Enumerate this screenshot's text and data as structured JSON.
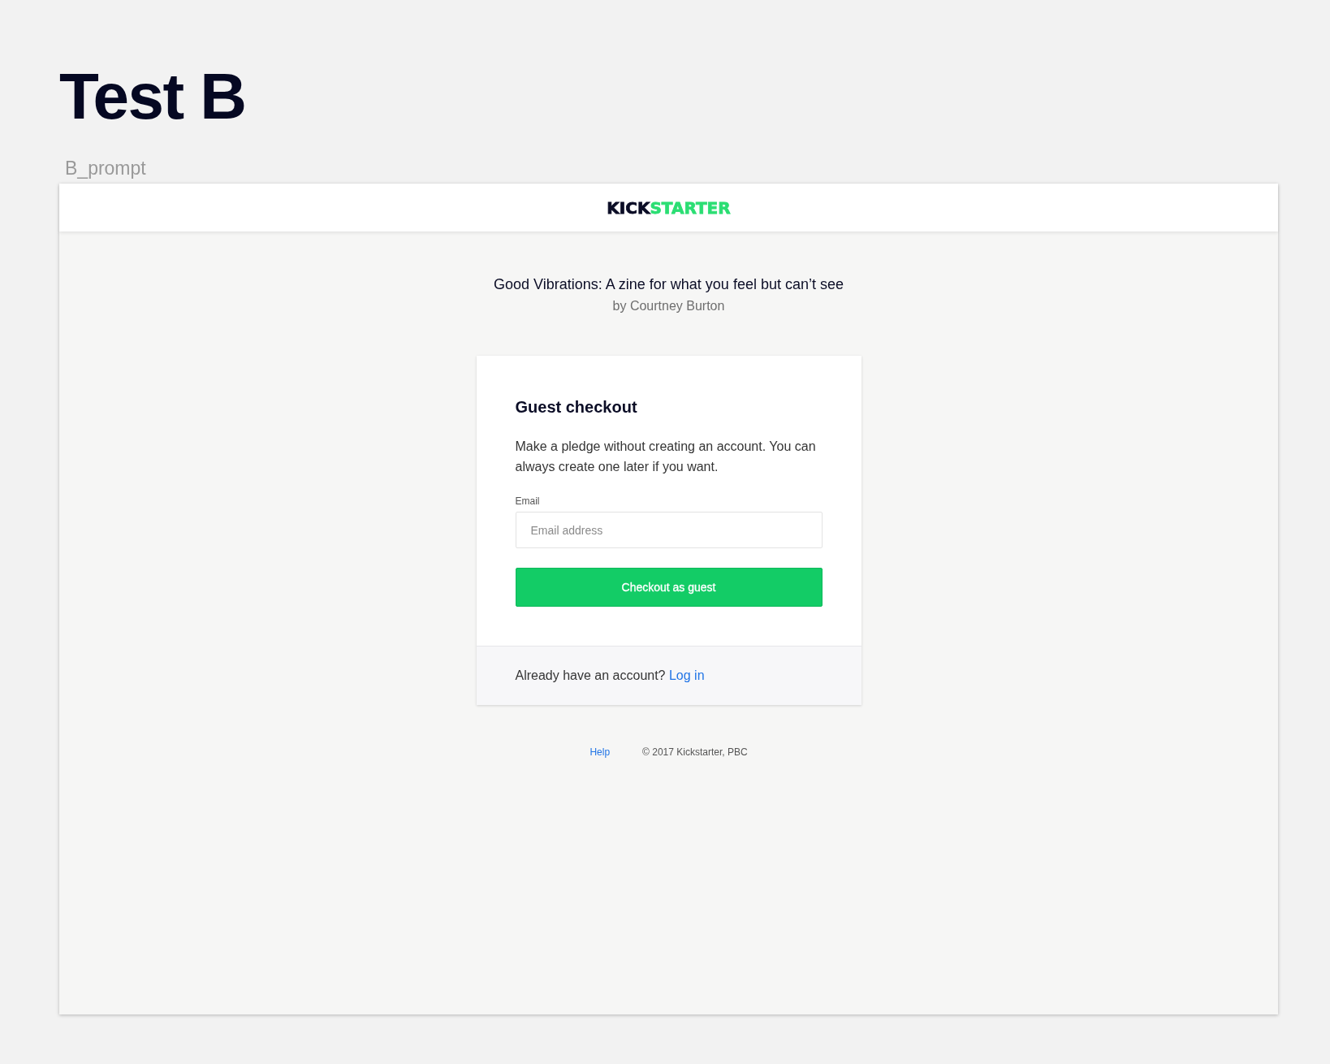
{
  "heading": "Test B",
  "frame_label": "B_prompt",
  "header": {
    "logo": [
      {
        "text": "KICK",
        "color": "#0b0d26"
      },
      {
        "text": "STARTER",
        "color": "#2bde73"
      }
    ]
  },
  "project": {
    "title": "Good Vibrations: A zine for what you feel but can’t see",
    "creator": "by Courtney Burton"
  },
  "card": {
    "title": "Guest checkout",
    "description": "Make a pledge without creating an account. You can always create one later if you want.",
    "email": {
      "label": "Email",
      "placeholder": "Email address"
    },
    "button": "Checkout as guest",
    "footer": {
      "text": "Already have an account?",
      "link": "Log in"
    }
  },
  "footer": {
    "link": "Help",
    "copyright": "© 2017 Kickstarter, PBC"
  }
}
